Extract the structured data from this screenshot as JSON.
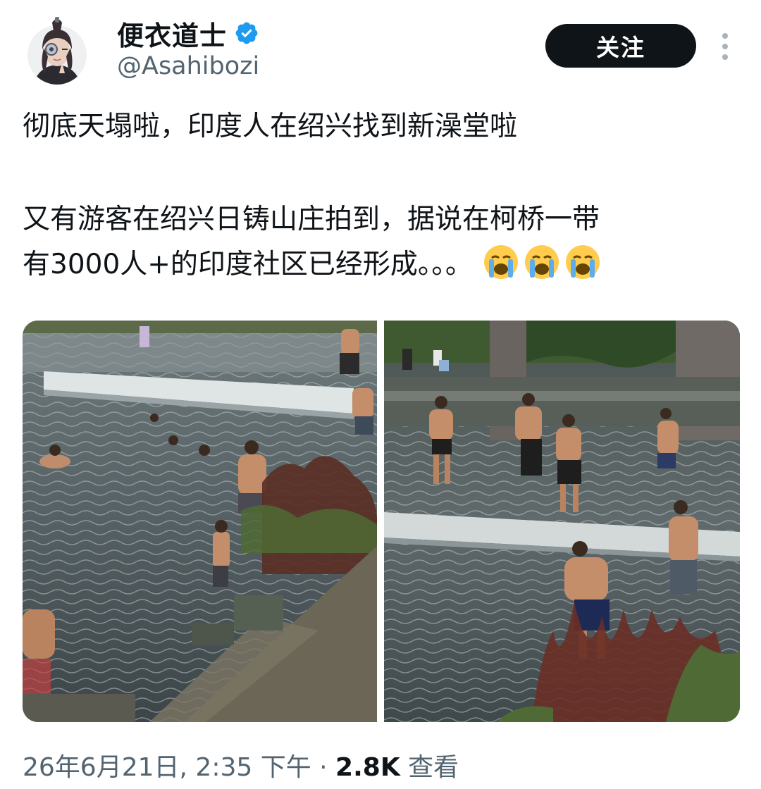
{
  "author": {
    "display_name": "便衣道士",
    "handle": "@Asahibozi",
    "avatar_icon": "avatar-icon",
    "verified_icon": "verified-badge-icon",
    "verified_color": "#1d9bf0"
  },
  "actions": {
    "follow_label": "关注",
    "more_icon": "more-dots-icon"
  },
  "post": {
    "line1": "彻底天塌啦，印度人在绍兴找到新澡堂啦",
    "line2": "又有游客在绍兴日铸山庄拍到，据说在柯桥一带",
    "line3": "有3000人+的印度社区已经形成。。。",
    "emoji_icons": [
      "loudly-crying-face-icon",
      "loudly-crying-face-icon",
      "loudly-crying-face-icon"
    ]
  },
  "media": {
    "photos": [
      {
        "icon": "river-swimmers-photo"
      },
      {
        "icon": "river-weir-men-photo"
      }
    ]
  },
  "meta": {
    "timestamp": "26年6月21日, 2:35 下午",
    "separator": " · ",
    "views_count": "2.8K",
    "views_label": " 查看"
  },
  "colors": {
    "text": "#0f1419",
    "secondary": "#536471",
    "button_bg": "#0f1419",
    "button_text": "#ffffff"
  }
}
